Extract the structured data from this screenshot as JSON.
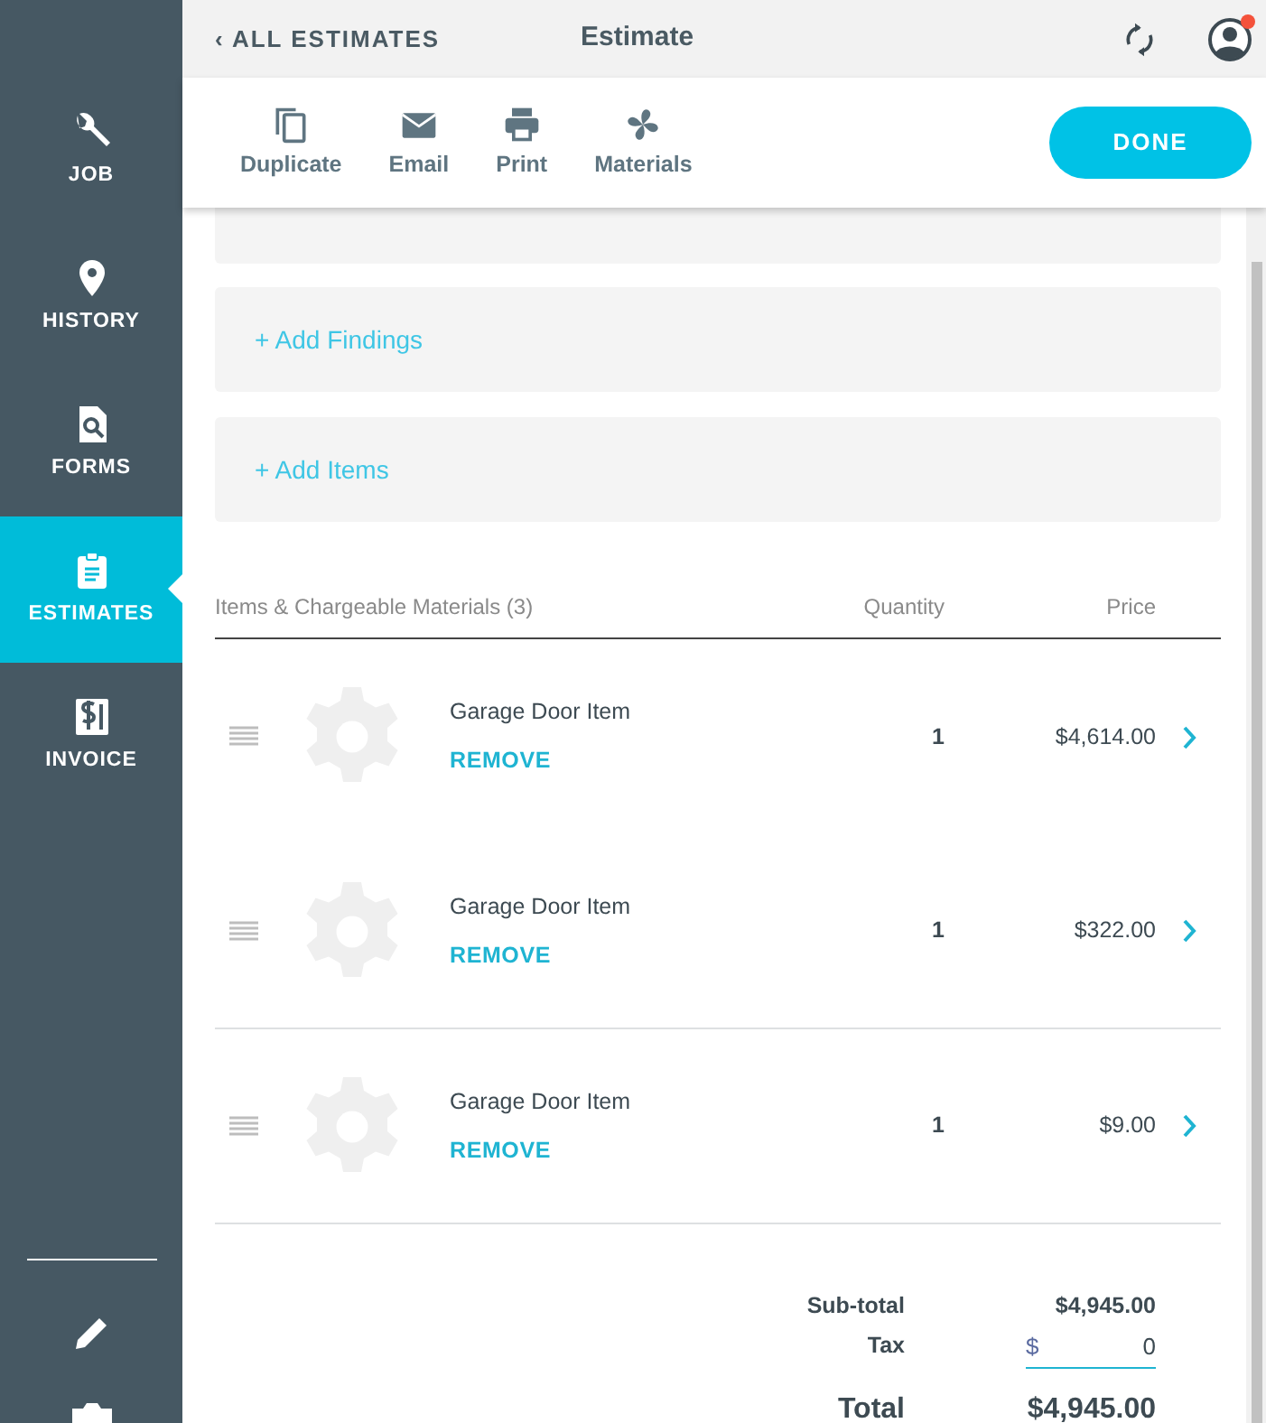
{
  "sidebar": {
    "items": [
      {
        "label": "JOB",
        "selected": false
      },
      {
        "label": "HISTORY",
        "selected": false
      },
      {
        "label": "FORMS",
        "selected": false
      },
      {
        "label": "ESTIMATES",
        "selected": true
      },
      {
        "label": "INVOICE",
        "selected": false
      }
    ]
  },
  "header": {
    "back": "‹ ALL ESTIMATES",
    "title": "Estimate",
    "notification": true
  },
  "toolbar": {
    "actions": [
      "Duplicate",
      "Email",
      "Print",
      "Materials"
    ],
    "done": "DONE"
  },
  "sections": [
    "+ Add Findings",
    "+ Add Items"
  ],
  "table": {
    "columns": [
      "Items & Chargeable Materials (3)",
      "Quantity",
      "Price"
    ],
    "rows": [
      {
        "name": "Garage Door Item",
        "action": "REMOVE",
        "quantity": "1",
        "price": "$4,614.00"
      },
      {
        "name": "Garage Door Item",
        "action": "REMOVE",
        "quantity": "1",
        "price": "$322.00"
      },
      {
        "name": "Garage Door Item",
        "action": "REMOVE",
        "quantity": "1",
        "price": "$9.00"
      }
    ]
  },
  "totals": {
    "subtotal_label": "Sub-total",
    "subtotal": "$4,945.00",
    "tax_label": "Tax",
    "tax_prefix": "$",
    "tax": "0",
    "total_label": "Total",
    "total": "$4,945.00"
  }
}
